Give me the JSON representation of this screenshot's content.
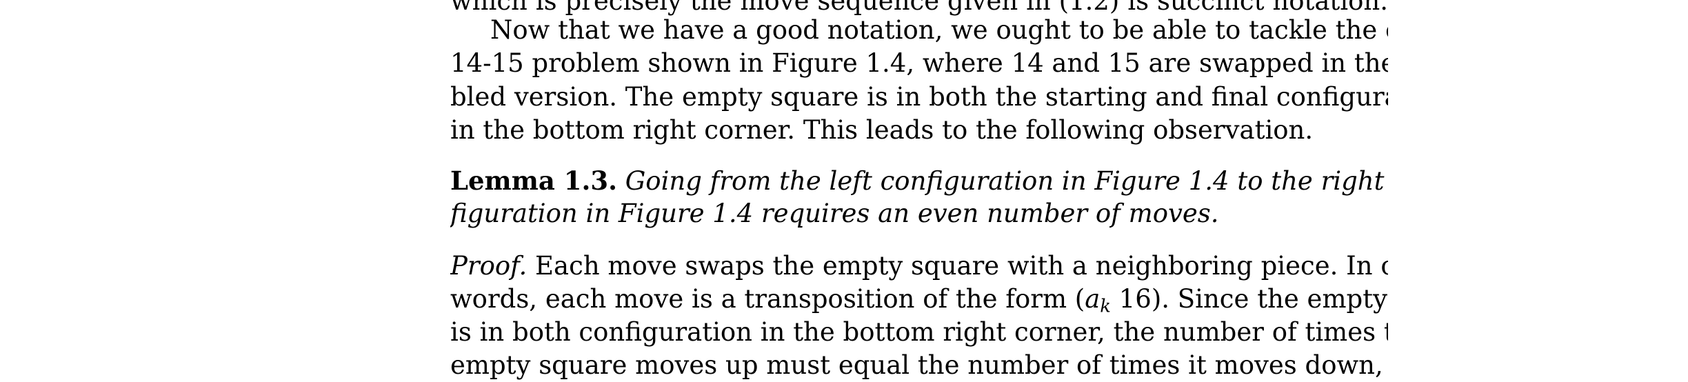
{
  "lines": [
    {
      "text": "which is precisely the move sequence given in (1.2) is succinct notation."
    },
    {
      "text": "Now that we have a good notation, we ought to be able to tackle the original"
    },
    {
      "text": "14-15 problem shown in Figure 1.4, where 14 and 15 are swapped in the scram-"
    },
    {
      "text": "bled version. The empty square is in both the starting and final configuration"
    },
    {
      "text": "in the bottom right corner. This leads to the following observation."
    }
  ],
  "lemma": {
    "label": "Lemma 1.3.",
    "line1": "Going from the left configuration in Figure 1.4 to the right con-",
    "line2": "figuration in Figure 1.4 requires an even number of moves."
  },
  "proof": {
    "label": "Proof.",
    "line1": "Each move swaps the empty square with a neighboring piece. In other",
    "line2_pre": "words, each move is a transposition of the form (",
    "math_var": "a",
    "math_sub": "k",
    "math_num": " 16",
    "line2_post": "). Since the empty square",
    "line3": "is in both configuration in the bottom right corner, the number of times the",
    "line4": "empty square moves up must equal the number of times it moves down, and"
  }
}
